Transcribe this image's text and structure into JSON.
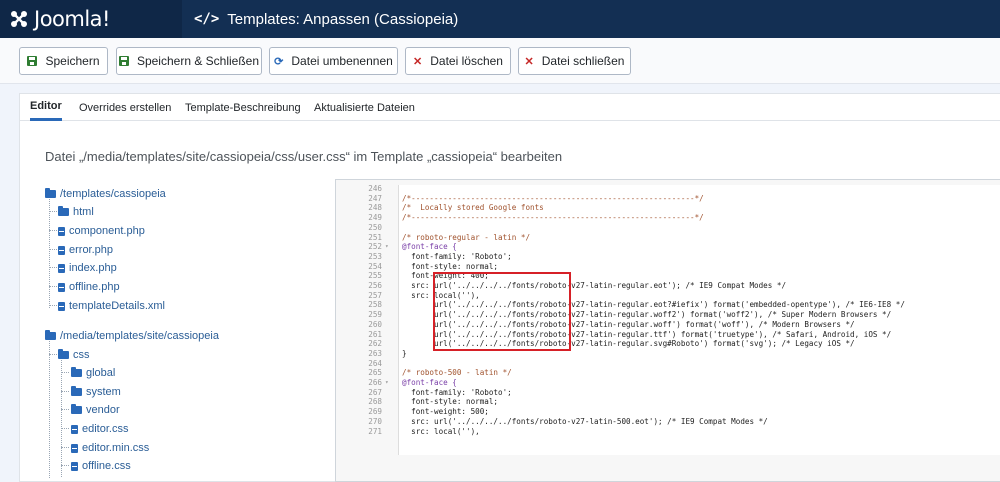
{
  "header": {
    "logo_text": "Joomla!",
    "page_title": "Templates: Anpassen (Cassiopeia)",
    "title_icon_text": "</>"
  },
  "toolbar": {
    "buttons": [
      {
        "label": "Speichern",
        "icon": "save-icon"
      },
      {
        "label": "Speichern & Schließen",
        "icon": "save-icon"
      },
      {
        "label": "Datei umbenennen",
        "icon": "sync-icon"
      },
      {
        "label": "Datei löschen",
        "icon": "close-icon"
      },
      {
        "label": "Datei schließen",
        "icon": "close-icon"
      }
    ]
  },
  "tabs": [
    {
      "label": "Editor",
      "active": true
    },
    {
      "label": "Overrides erstellen",
      "active": false
    },
    {
      "label": "Template-Beschreibung",
      "active": false
    },
    {
      "label": "Aktualisierte Dateien",
      "active": false
    }
  ],
  "main": {
    "heading": "Datei „/media/templates/site/cassiopeia/css/user.css“ im Template „cassiopeia“ bearbeiten"
  },
  "tree": [
    {
      "label": "/templates/cassiopeia",
      "type": "folder"
    },
    {
      "label": "html",
      "type": "folder"
    },
    {
      "label": "component.php",
      "type": "file"
    },
    {
      "label": "error.php",
      "type": "file"
    },
    {
      "label": "index.php",
      "type": "file"
    },
    {
      "label": "offline.php",
      "type": "file"
    },
    {
      "label": "templateDetails.xml",
      "type": "file"
    },
    {
      "label": "/media/templates/site/cassiopeia",
      "type": "folder"
    },
    {
      "label": "css",
      "type": "folder"
    },
    {
      "label": "global",
      "type": "folder"
    },
    {
      "label": "system",
      "type": "folder"
    },
    {
      "label": "vendor",
      "type": "folder"
    },
    {
      "label": "editor.css",
      "type": "file"
    },
    {
      "label": "editor.min.css",
      "type": "file"
    },
    {
      "label": "offline.css",
      "type": "file"
    }
  ],
  "code_lines": [
    {
      "n": "246",
      "t": ""
    },
    {
      "n": "247",
      "t": "/*--------------------------------------------------------------*/"
    },
    {
      "n": "248",
      "t": "/*  Locally stored Google fonts"
    },
    {
      "n": "249",
      "t": "/*--------------------------------------------------------------*/"
    },
    {
      "n": "250",
      "t": ""
    },
    {
      "n": "251",
      "t": "/* roboto-regular - latin */"
    },
    {
      "n": "252",
      "t": "@font-face {"
    },
    {
      "n": "253",
      "t": "  font-family: 'Roboto';"
    },
    {
      "n": "254",
      "t": "  font-style: normal;"
    },
    {
      "n": "255",
      "t": "  font-weight: 400;"
    },
    {
      "n": "256",
      "t": "  src: url('../../../../fonts/roboto-v27-latin-regular.eot'); /* IE9 Compat Modes */"
    },
    {
      "n": "257",
      "t": "  src: local(''),"
    },
    {
      "n": "258",
      "t": "       url('../../../../fonts/roboto-v27-latin-regular.eot?#iefix') format('embedded-opentype'), /* IE6-IE8 */"
    },
    {
      "n": "259",
      "t": "       url('../../../../fonts/roboto-v27-latin-regular.woff2') format('woff2'), /* Super Modern Browsers */"
    },
    {
      "n": "260",
      "t": "       url('../../../../fonts/roboto-v27-latin-regular.woff') format('woff'), /* Modern Browsers */"
    },
    {
      "n": "261",
      "t": "       url('../../../../fonts/roboto-v27-latin-regular.ttf') format('truetype'), /* Safari, Android, iOS */"
    },
    {
      "n": "262",
      "t": "       url('../../../../fonts/roboto-v27-latin-regular.svg#Roboto') format('svg'); /* Legacy iOS */"
    },
    {
      "n": "263",
      "t": "}"
    },
    {
      "n": "264",
      "t": ""
    },
    {
      "n": "265",
      "t": "/* roboto-500 - latin */"
    },
    {
      "n": "266",
      "t": "@font-face {"
    },
    {
      "n": "267",
      "t": "  font-family: 'Roboto';"
    },
    {
      "n": "268",
      "t": "  font-style: normal;"
    },
    {
      "n": "269",
      "t": "  font-weight: 500;"
    },
    {
      "n": "270",
      "t": "  src: url('../../../../fonts/roboto-v27-latin-500.eot'); /* IE9 Compat Modes */"
    },
    {
      "n": "271",
      "t": "  src: local(''),"
    }
  ],
  "colors": {
    "topbar": "#132f53",
    "accent": "#2a69b8",
    "danger": "#c52827",
    "success": "#2f7d32",
    "highlight_box": "#d62027"
  }
}
